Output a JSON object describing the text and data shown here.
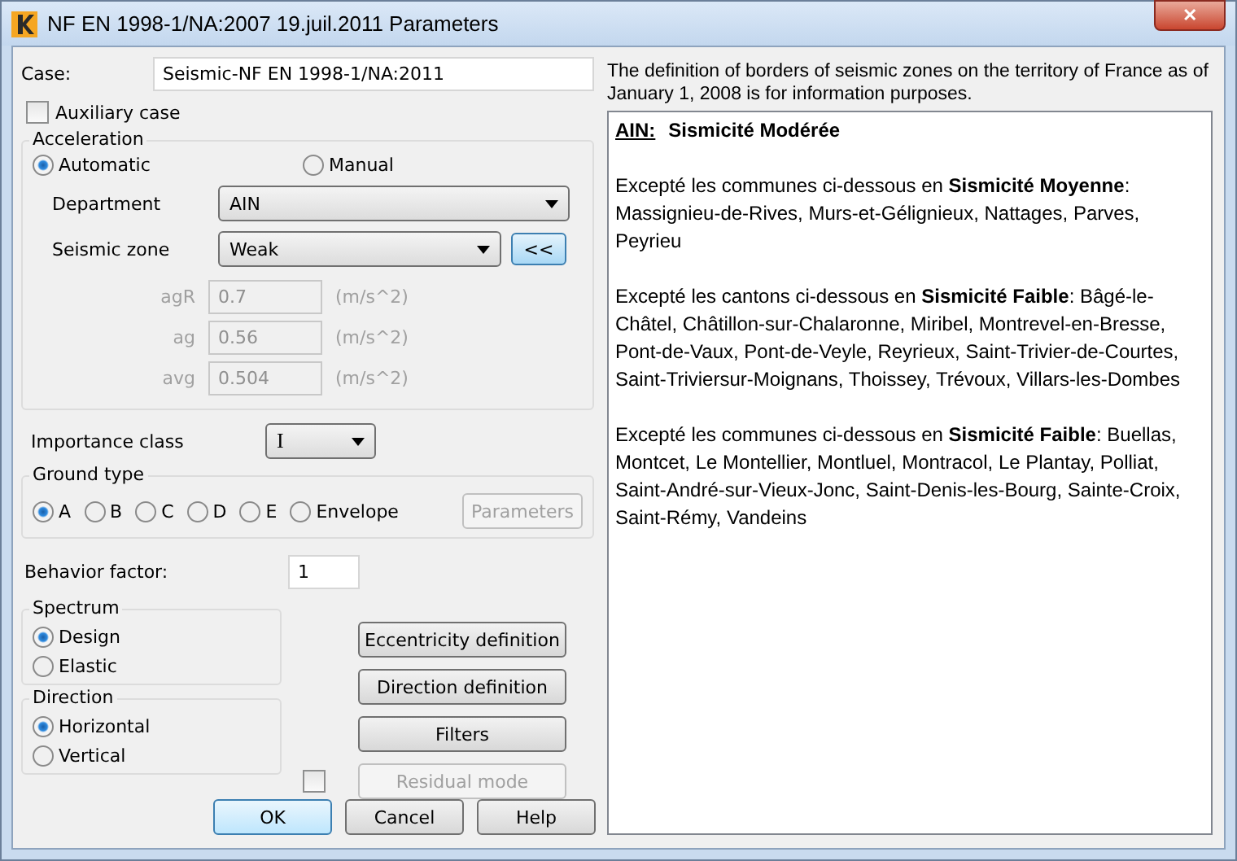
{
  "window": {
    "title": "NF EN 1998-1/NA:2007 19.juil.2011 Parameters",
    "close": "✕"
  },
  "case": {
    "label": "Case:",
    "value": "Seismic-NF EN 1998-1/NA:2011"
  },
  "auxiliary": {
    "label": "Auxiliary case",
    "checked": false
  },
  "acceleration": {
    "legend": "Acceleration",
    "modes": [
      {
        "label": "Automatic",
        "selected": true
      },
      {
        "label": "Manual",
        "selected": false
      }
    ],
    "department": {
      "label": "Department",
      "value": "AIN"
    },
    "seismic_zone": {
      "label": "Seismic zone",
      "value": "Weak",
      "button": "<<"
    },
    "values": [
      {
        "label": "agR",
        "value": "0.7",
        "unit": "(m/s^2)",
        "disabled": true
      },
      {
        "label": "ag",
        "value": "0.56",
        "unit": "(m/s^2)",
        "disabled": true
      },
      {
        "label": "avg",
        "value": "0.504",
        "unit": "(m/s^2)",
        "disabled": true
      }
    ]
  },
  "importance_class": {
    "label": "Importance class",
    "value": "I"
  },
  "ground_type": {
    "legend": "Ground type",
    "options": [
      {
        "label": "A",
        "selected": true
      },
      {
        "label": "B",
        "selected": false
      },
      {
        "label": "C",
        "selected": false
      },
      {
        "label": "D",
        "selected": false
      },
      {
        "label": "E",
        "selected": false
      },
      {
        "label": "Envelope",
        "selected": false
      }
    ],
    "parameters_button": {
      "label": "Parameters",
      "disabled": true
    }
  },
  "behavior_factor": {
    "label": "Behavior factor:",
    "value": "1"
  },
  "spectrum": {
    "legend": "Spectrum",
    "options": [
      {
        "label": "Design",
        "selected": true
      },
      {
        "label": "Elastic",
        "selected": false
      }
    ]
  },
  "direction": {
    "legend": "Direction",
    "options": [
      {
        "label": "Horizontal",
        "selected": true
      },
      {
        "label": "Vertical",
        "selected": false
      }
    ]
  },
  "side_buttons": [
    {
      "label": "Eccentricity definition",
      "disabled": false
    },
    {
      "label": "Direction definition",
      "disabled": false
    },
    {
      "label": "Filters",
      "disabled": false
    }
  ],
  "residual": {
    "checked": false,
    "label": "Residual mode",
    "disabled": true
  },
  "buttons": [
    {
      "label": "OK",
      "default": true
    },
    {
      "label": "Cancel",
      "default": false
    },
    {
      "label": "Help",
      "default": false
    }
  ],
  "info": {
    "note": "The definition of borders of seismic zones on the territory of France as of January 1, 2008 is for information purposes.",
    "heading": {
      "code": "AIN:",
      "title": "Sismicité Modérée"
    },
    "paragraphs": [
      "Excepté les communes ci-dessous en **Sismicité Moyenne**: Massignieu-de-Rives, Murs-et-Gélignieux, Nattages, Parves, Peyrieu",
      "Excepté les cantons ci-dessous en **Sismicité Faible**: Bâgé-le-Châtel, Châtillon-sur-Chalaronne, Miribel, Montrevel-en-Bresse, Pont-de-Vaux, Pont-de-Veyle, Reyrieux, Saint-Trivier-de-Courtes, Saint-Triviersur-Moignans, Thoissey, Trévoux, Villars-les-Dombes",
      "Excepté les communes ci-dessous en **Sismicité Faible**: Buellas, Montcet, Le Montellier, Montluel, Montracol, Le Plantay, Polliat, Saint-André-sur-Vieux-Jonc, Saint-Denis-les-Bourg, Sainte-Croix, Saint-Rémy, Vandeins"
    ]
  }
}
